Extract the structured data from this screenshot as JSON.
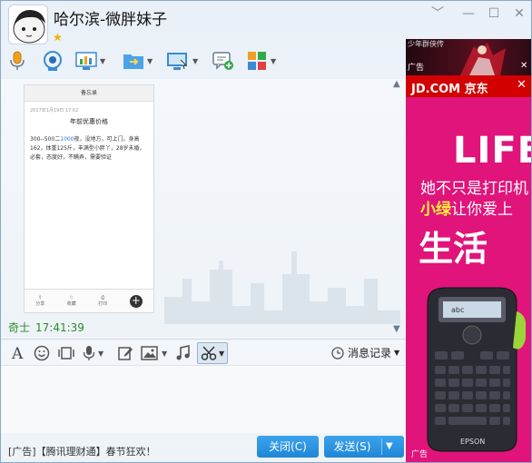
{
  "window": {
    "title": "哈尔滨-微胖妹子",
    "controls": [
      "﹀",
      "—",
      "☐",
      "✕"
    ]
  },
  "toolbar": {
    "items": [
      "voice-call",
      "video-call",
      "screen-share",
      "file-transfer",
      "remote-desktop",
      "chat-add",
      "apps"
    ]
  },
  "chat": {
    "image_card": {
      "header": "备忘录",
      "date": "2017年1月19日 17:02",
      "title": "年前优惠价格",
      "body_pre": "300--500二",
      "body_num": "1000",
      "body_post": "夜，没地方，可上门。身高162，体重125斤，丰满型小胖丫，28岁未婚，必套，态度好，不瞒弄，需要验证",
      "bottom_buttons": [
        "分享",
        "收藏",
        "打印"
      ],
      "plus": "+"
    },
    "message": {
      "sender": "奇士",
      "time": "17:41:39"
    }
  },
  "input_toolbar": {
    "message_record_label": "消息记录"
  },
  "bottom": {
    "ad_text": "[广告]【腾讯理财通】春节狂欢！",
    "close_button": "关闭(C)",
    "send_button": "发送(S)"
  },
  "ads": {
    "game": {
      "text": "少年群侠传",
      "tag": "广告",
      "close": "✕"
    },
    "jd": {
      "logo": "JD.COM 京东",
      "close": "✕",
      "headline": "LIFE",
      "line1": "她不只是打印机",
      "line2_highlight": "小绿",
      "line2_rest": "让你爱上",
      "line3": "生活",
      "tag": "广告",
      "brand": "EPSON"
    }
  },
  "colors": {
    "accent_blue": "#1f86d6",
    "sender_green": "#2a8a2a",
    "jd_red": "#d20000",
    "jd_pink": "#e0147a"
  }
}
